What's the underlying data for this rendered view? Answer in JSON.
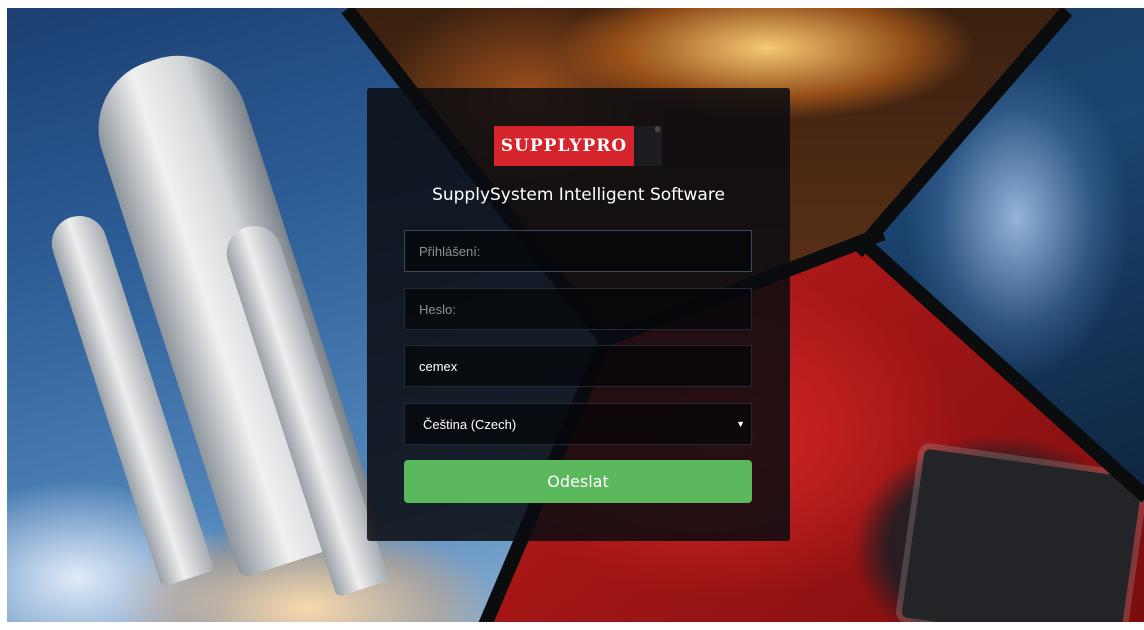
{
  "app": {
    "logo_text": "SUPPLYPRO",
    "logo_mark": "®",
    "subtitle": "SupplySystem Intelligent Software"
  },
  "form": {
    "login": {
      "placeholder": "Přihlášení:",
      "value": ""
    },
    "password": {
      "placeholder": "Heslo:",
      "value": ""
    },
    "company": {
      "value": "cemex"
    },
    "language": {
      "selected": "Čeština (Czech)",
      "caret_icon": "triangle-down"
    },
    "submit_label": "Odeslat"
  },
  "colors": {
    "brand_red": "#d5242b",
    "submit_green": "#5cb85c",
    "card_bg": "#0a0c10"
  }
}
